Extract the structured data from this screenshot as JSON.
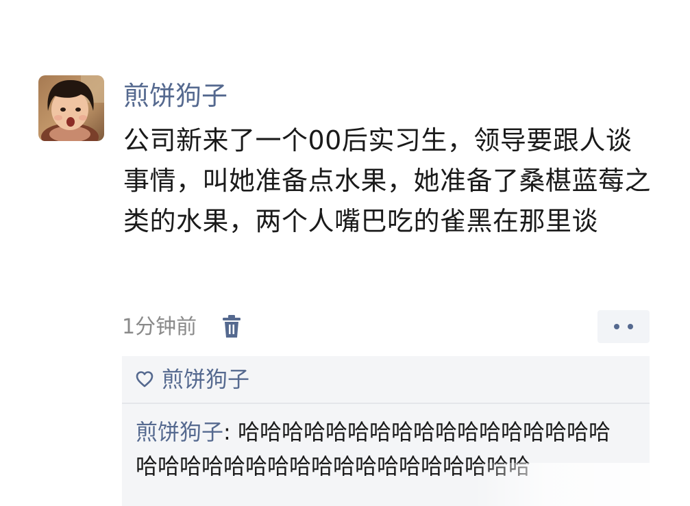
{
  "post": {
    "username": "煎饼狗子",
    "content": "公司新来了一个00后实习生，领导要跟人谈事情，叫她准备点水果，她准备了桑椹蓝莓之类的水果，两个人嘴巴吃的雀黑在那里谈",
    "time": "1分钟前",
    "icons": {
      "avatar": "avatar-photo",
      "delete": "trash-icon",
      "more": "more-dots-icon"
    }
  },
  "interaction": {
    "likes": [
      "煎饼狗子"
    ],
    "like_icon": "heart-icon",
    "comments": [
      {
        "author": "煎饼狗子",
        "separator": ": ",
        "text": "哈哈哈哈哈哈哈哈哈哈哈哈哈哈哈哈哈哈哈哈哈哈哈哈哈哈哈哈哈哈哈哈哈哈哈"
      }
    ]
  },
  "colors": {
    "name_blue": "#55698f",
    "text": "#1a1a1a",
    "secondary": "#8a8a8a",
    "panel_bg": "#f4f5f7"
  }
}
